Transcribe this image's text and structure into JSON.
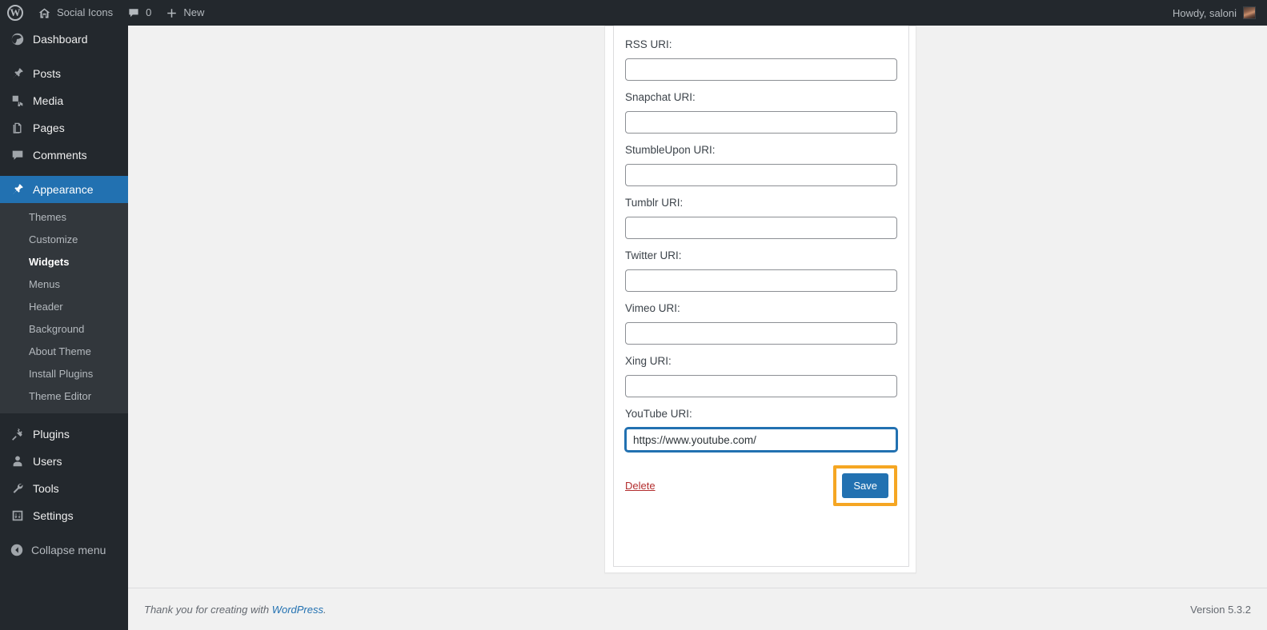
{
  "admin_bar": {
    "logo_icon": "wordpress-logo-icon",
    "site_icon": "home-icon",
    "site_name": "Social Icons",
    "comments_icon": "comment-bubble-icon",
    "comments_count": "0",
    "new_icon": "plus-icon",
    "new_label": "New",
    "howdy": "Howdy, saloni",
    "avatar_icon": "user-avatar"
  },
  "sidebar": {
    "top_items": [
      {
        "label": "Dashboard",
        "icon": "dashboard-icon",
        "active": false
      },
      {
        "label": "Posts",
        "icon": "pin-icon",
        "active": false
      },
      {
        "label": "Media",
        "icon": "media-icon",
        "active": false
      },
      {
        "label": "Pages",
        "icon": "pages-icon",
        "active": false
      },
      {
        "label": "Comments",
        "icon": "comment-bubble-icon",
        "active": false
      },
      {
        "label": "Appearance",
        "icon": "paintbrush-icon",
        "active": true
      }
    ],
    "submenu": [
      {
        "label": "Themes",
        "current": false
      },
      {
        "label": "Customize",
        "current": false
      },
      {
        "label": "Widgets",
        "current": true
      },
      {
        "label": "Menus",
        "current": false
      },
      {
        "label": "Header",
        "current": false
      },
      {
        "label": "Background",
        "current": false
      },
      {
        "label": "About Theme",
        "current": false
      },
      {
        "label": "Install Plugins",
        "current": false
      },
      {
        "label": "Theme Editor",
        "current": false
      }
    ],
    "bottom_items": [
      {
        "label": "Plugins",
        "icon": "plug-icon"
      },
      {
        "label": "Users",
        "icon": "user-icon"
      },
      {
        "label": "Tools",
        "icon": "wrench-icon"
      },
      {
        "label": "Settings",
        "icon": "sliders-icon"
      }
    ],
    "collapse": {
      "label": "Collapse menu",
      "icon": "collapse-arrow-icon"
    }
  },
  "widget": {
    "fields": [
      {
        "label": "RSS URI:",
        "value": "",
        "placeholder": "",
        "focused": false
      },
      {
        "label": "Snapchat URI:",
        "value": "",
        "placeholder": "",
        "focused": false
      },
      {
        "label": "StumbleUpon URI:",
        "value": "",
        "placeholder": "",
        "focused": false
      },
      {
        "label": "Tumblr URI:",
        "value": "",
        "placeholder": "",
        "focused": false
      },
      {
        "label": "Twitter URI:",
        "value": "",
        "placeholder": "",
        "focused": false
      },
      {
        "label": "Vimeo URI:",
        "value": "",
        "placeholder": "",
        "focused": false
      },
      {
        "label": "Xing URI:",
        "value": "",
        "placeholder": "",
        "focused": false
      },
      {
        "label": "YouTube URI:",
        "value": "https://www.youtube.com/",
        "placeholder": "",
        "focused": true
      }
    ],
    "delete_label": "Delete",
    "save_label": "Save",
    "highlight_color": "#f5a623",
    "accent_color": "#2271b1",
    "delete_color": "#b32d2e"
  },
  "footer": {
    "thanks_prefix": "Thank you for creating with ",
    "wordpress_link": "WordPress",
    "thanks_suffix": ".",
    "version": "Version 5.3.2"
  }
}
